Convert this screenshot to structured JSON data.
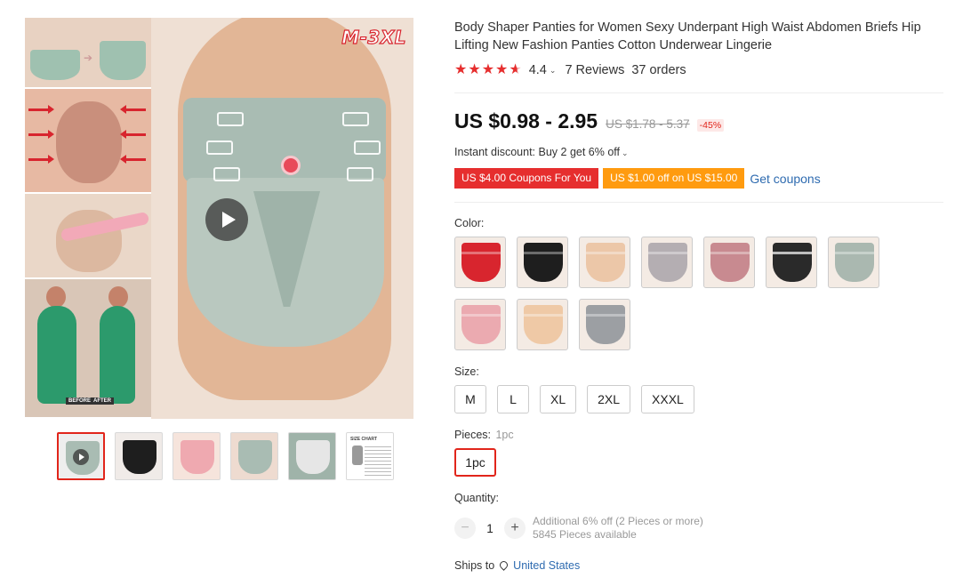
{
  "gallery": {
    "main_badge": "M-3XL",
    "chart_thumb_label": "SIZE CHART",
    "before_label": "BEFORE",
    "after_label": "AFTER"
  },
  "product": {
    "title": "Body Shaper Panties for Women Sexy Underpant High Waist Abdomen Briefs Hip Lifting New Fashion Panties Cotton Underwear Lingerie",
    "rating": "4.4",
    "rating_value": 4.4,
    "reviews": "7 Reviews",
    "orders": "37 orders",
    "price": "US $0.98 - 2.95",
    "original_price": "US $1.78 - 5.37",
    "discount": "-45%",
    "instant_discount": "Instant discount: Buy 2 get 6% off",
    "coupons": [
      {
        "label": "US $4.00 Coupons For You",
        "color": "#e62e2e"
      },
      {
        "label": "US $1.00 off on US $15.00",
        "color": "#ff9b0f"
      }
    ],
    "get_coupons": "Get coupons"
  },
  "options": {
    "color_label": "Color:",
    "colors": [
      {
        "name": "red",
        "hex": "#d8252e"
      },
      {
        "name": "black",
        "hex": "#1e1e1e"
      },
      {
        "name": "beige",
        "hex": "#ecc7a8"
      },
      {
        "name": "gray",
        "hex": "#b4aeb2"
      },
      {
        "name": "rose",
        "hex": "#c88a90"
      },
      {
        "name": "black-stripe",
        "hex": "#2a2a2a"
      },
      {
        "name": "mint",
        "hex": "#aab8b0"
      },
      {
        "name": "pink",
        "hex": "#ebaab0"
      },
      {
        "name": "skin",
        "hex": "#efc9a6"
      },
      {
        "name": "slate",
        "hex": "#9c9fa3"
      }
    ],
    "size_label": "Size:",
    "sizes": [
      "M",
      "L",
      "XL",
      "2XL",
      "XXXL"
    ],
    "pieces_label": "Pieces:",
    "pieces_selected": "1pc",
    "pieces": [
      "1pc"
    ],
    "quantity_label": "Quantity:",
    "quantity": "1",
    "qty_minus": "−",
    "qty_plus": "+",
    "qty_note": "Additional 6% off (2 Pieces or more)",
    "available": "5845 Pieces available"
  },
  "shipping": {
    "label": "Ships to",
    "country": "United States"
  },
  "colors": {
    "accent": "#e1251b",
    "link": "#2e6bb0",
    "star": "#e62e2e"
  }
}
